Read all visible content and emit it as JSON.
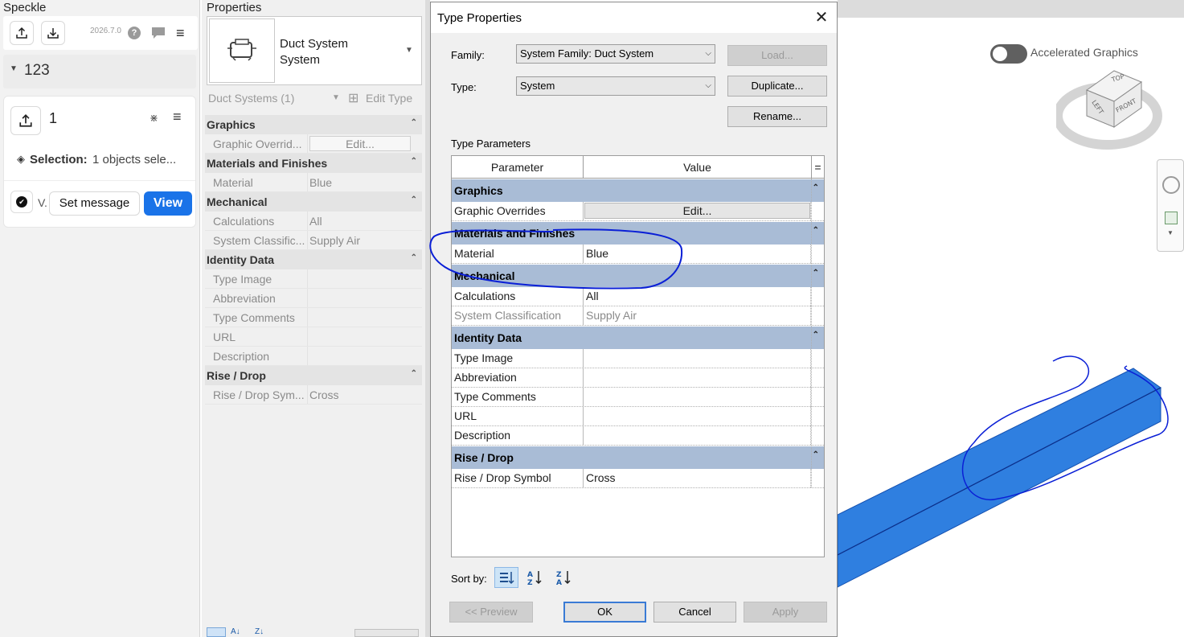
{
  "speckle": {
    "title": "Speckle",
    "version": "2026.7.0",
    "project_name": "123",
    "model_name": "1",
    "selection_label": "Selection:",
    "selection_value": "1 objects sele...",
    "version_short": "V.",
    "set_message_label": "Set message",
    "view_label": "View"
  },
  "properties": {
    "title": "Properties",
    "type_name": [
      "Duct System",
      "System"
    ],
    "selector": "Duct Systems (1)",
    "edit_type_label": "Edit Type",
    "groups": [
      {
        "name": "Graphics",
        "rows": [
          {
            "param": "Graphic Overrid...",
            "value": "Edit...",
            "is_button": true
          }
        ]
      },
      {
        "name": "Materials and Finishes",
        "rows": [
          {
            "param": "Material",
            "value": "Blue"
          }
        ]
      },
      {
        "name": "Mechanical",
        "rows": [
          {
            "param": "Calculations",
            "value": "All"
          },
          {
            "param": "System Classific...",
            "value": "Supply Air"
          }
        ]
      },
      {
        "name": "Identity Data",
        "rows": [
          {
            "param": "Type Image",
            "value": ""
          },
          {
            "param": "Abbreviation",
            "value": ""
          },
          {
            "param": "Type Comments",
            "value": ""
          },
          {
            "param": "URL",
            "value": ""
          },
          {
            "param": "Description",
            "value": ""
          }
        ]
      },
      {
        "name": "Rise / Drop",
        "rows": [
          {
            "param": "Rise / Drop Sym...",
            "value": "Cross"
          }
        ]
      }
    ]
  },
  "dialog": {
    "title": "Type Properties",
    "family_label": "Family:",
    "family_value": "System Family: Duct System",
    "type_label": "Type:",
    "type_value": "System",
    "load_label": "Load...",
    "duplicate_label": "Duplicate...",
    "rename_label": "Rename...",
    "type_params_label": "Type Parameters",
    "col_parameter": "Parameter",
    "col_value": "Value",
    "col_eq": "=",
    "groups": [
      {
        "name": "Graphics",
        "rows": [
          {
            "param": "Graphic Overrides",
            "value": "Edit...",
            "is_button": true
          }
        ]
      },
      {
        "name": "Materials and Finishes",
        "rows": [
          {
            "param": "Material",
            "value": "Blue"
          }
        ]
      },
      {
        "name": "Mechanical",
        "rows": [
          {
            "param": "Calculations",
            "value": "All"
          },
          {
            "param": "System Classification",
            "value": "Supply Air",
            "grey": true
          }
        ]
      },
      {
        "name": "Identity Data",
        "rows": [
          {
            "param": "Type Image",
            "value": ""
          },
          {
            "param": "Abbreviation",
            "value": ""
          },
          {
            "param": "Type Comments",
            "value": ""
          },
          {
            "param": "URL",
            "value": ""
          },
          {
            "param": "Description",
            "value": ""
          }
        ]
      },
      {
        "name": "Rise / Drop",
        "rows": [
          {
            "param": "Rise / Drop Symbol",
            "value": "Cross"
          }
        ]
      }
    ],
    "sort_label": "Sort by:",
    "preview_label": "<< Preview",
    "ok_label": "OK",
    "cancel_label": "Cancel",
    "apply_label": "Apply"
  },
  "viewport": {
    "accelerated_label": "Accelerated Graphics",
    "cube_top": "TOP",
    "cube_left": "LEFT",
    "cube_front": "FRONT",
    "duct_color": "#2f7fe0",
    "annotation_color": "#0a1fd6"
  }
}
